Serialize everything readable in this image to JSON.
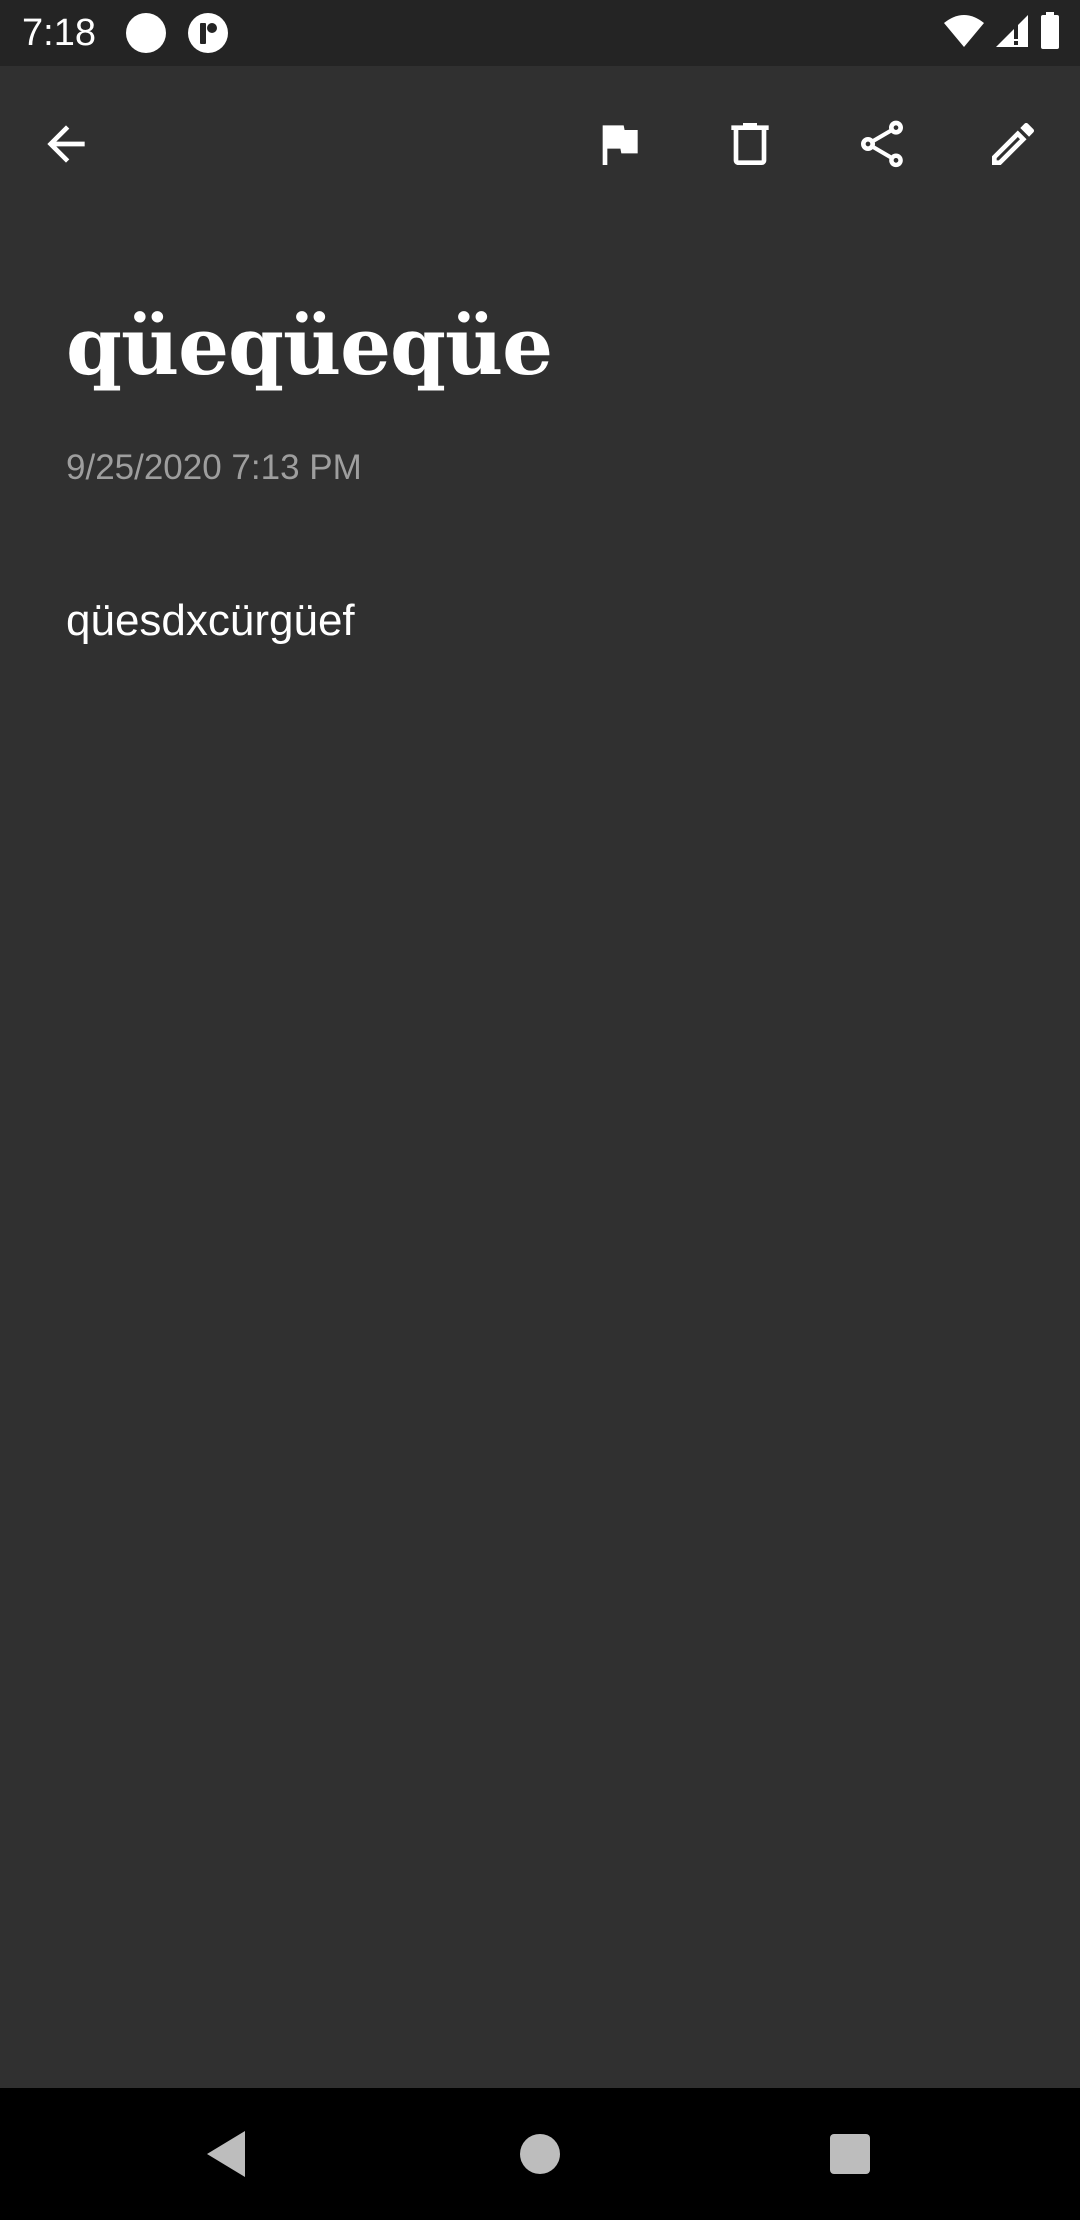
{
  "status_bar": {
    "time": "7:18",
    "icons": [
      "notification-dot-icon",
      "app-notification-icon",
      "wifi-icon",
      "cell-signal-icon",
      "battery-icon"
    ]
  },
  "toolbar": {
    "icons": [
      "back-arrow-icon",
      "flag-icon",
      "delete-icon",
      "share-icon",
      "edit-pencil-icon"
    ]
  },
  "note": {
    "title": "qüeqüeqüe",
    "date": "9/25/2020 7:13 PM",
    "body": "qüesdxcürgüef"
  },
  "nav_bar": {
    "icons": [
      "nav-back-icon",
      "nav-home-icon",
      "nav-recents-icon"
    ]
  },
  "colors": {
    "background": "#303030",
    "status_bar": "#242424",
    "nav_bar": "#000000",
    "text_primary": "#ffffff",
    "text_secondary": "#9e9e9e"
  }
}
